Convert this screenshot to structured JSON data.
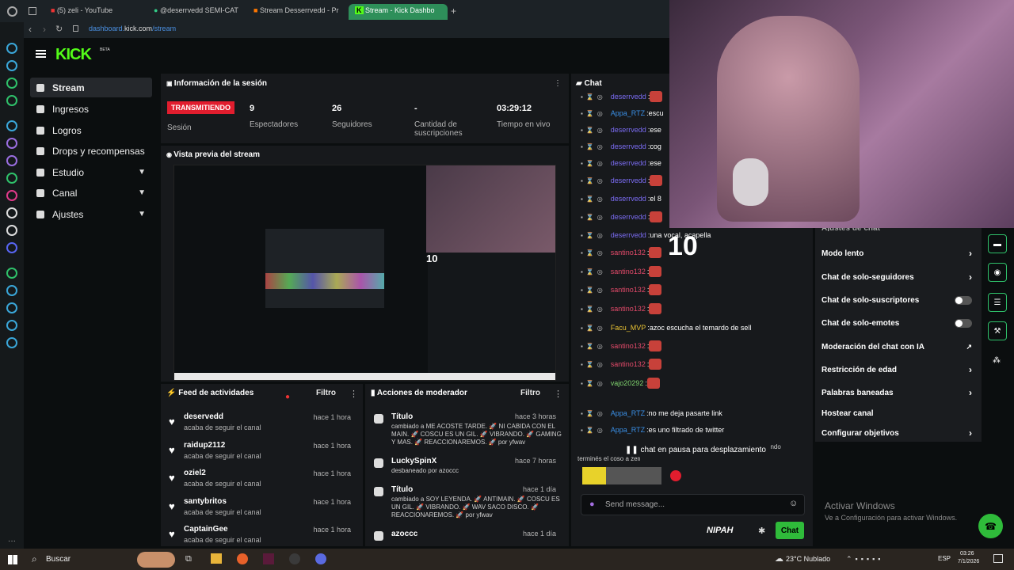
{
  "browser": {
    "tabs": [
      "(5) zeli - YouTube",
      "@deserrvedd SEMI-CAT",
      "Stream Desserrvedd - Pr",
      "Stream - Kick Dashbo"
    ],
    "url_path": "dashboard.",
    "url_host": "kick.com",
    "url_rest": "/stream"
  },
  "kick": {
    "logo": "KICK",
    "logo_badge": "BETA",
    "nav": [
      {
        "label": "Stream",
        "icon": "stream-icon"
      },
      {
        "label": "Ingresos",
        "icon": "money-icon"
      },
      {
        "label": "Logros",
        "icon": "trophy-icon"
      },
      {
        "label": "Drops y recompensas",
        "icon": "gift-icon"
      },
      {
        "label": "Estudio",
        "icon": "pen-icon"
      },
      {
        "label": "Canal",
        "icon": "user-icon"
      },
      {
        "label": "Ajustes",
        "icon": "gear-icon"
      }
    ],
    "session": {
      "title": "Información de la sesión",
      "live_badge": "TRANSMITIENDO",
      "session_label": "Sesión",
      "stats": [
        {
          "value": "9",
          "label": "Espectadores"
        },
        {
          "value": "26",
          "label": "Seguidores"
        },
        {
          "value": "-",
          "label": "Cantidad de suscripciones"
        },
        {
          "value": "03:29:12",
          "label": "Tiempo en vivo"
        }
      ]
    },
    "preview": {
      "title": "Vista previa del stream",
      "big_number": "10"
    },
    "feed": {
      "title": "Feed de actividades",
      "filter": "Filtro",
      "items": [
        {
          "user": "deservedd",
          "text": "acaba de seguir el canal",
          "time": "hace 1 hora"
        },
        {
          "user": "raidup2112",
          "text": "acaba de seguir el canal",
          "time": "hace 1 hora"
        },
        {
          "user": "oziel2",
          "text": "acaba de seguir el canal",
          "time": "hace 1 hora"
        },
        {
          "user": "santybritos",
          "text": "acaba de seguir el canal",
          "time": "hace 1 hora"
        },
        {
          "user": "CaptainGee",
          "text": "acaba de seguir el canal",
          "time": "hace 1 hora"
        }
      ]
    },
    "mod": {
      "title": "Acciones de moderador",
      "filter": "Filtro",
      "items": [
        {
          "title": "Título",
          "time": "hace 3 horas",
          "desc": "cambiado a ME ACOSTE TARDE. 🚀 NI CABIDA CON EL MAIN. 🚀 COSCU ES UN GIL. 🚀 VIBRANDO. 🚀 GAMING Y MAS. 🚀 REACCIONAREMOS. 🚀 por yfwav"
        },
        {
          "title": "LuckySpinX",
          "time": "hace 7 horas",
          "desc": "desbaneado por azoccc"
        },
        {
          "title": "Título",
          "time": "hace 1 día",
          "desc": "cambiado a SOY LEYENDA. 🚀 ANTIMAIN. 🚀 COSCU ES UN GIL. 🚀 VIBRANDO. 🚀 WAV SACO DISCO. 🚀 REACCIONAREMOS. 🚀 por yfwav"
        },
        {
          "title": "azoccc",
          "time": "hace 1 día",
          "desc": ""
        }
      ]
    },
    "chat": {
      "title": "Chat",
      "lines": [
        {
          "user": "deserrvedd",
          "msg": "",
          "color": "#7b6cf3"
        },
        {
          "user": "Appa_RTZ",
          "msg": "escu",
          "color": "#3a8fe6"
        },
        {
          "user": "deserrvedd",
          "msg": "ese",
          "color": "#7b6cf3"
        },
        {
          "user": "deserrvedd",
          "msg": "cog",
          "color": "#7b6cf3"
        },
        {
          "user": "deserrvedd",
          "msg": "ese",
          "color": "#7b6cf3"
        },
        {
          "user": "deserrvedd",
          "msg": "",
          "color": "#7b6cf3"
        },
        {
          "user": "deserrvedd",
          "msg": "el 8",
          "color": "#7b6cf3"
        },
        {
          "user": "deserrvedd",
          "msg": "",
          "color": "#7b6cf3"
        },
        {
          "user": "deserrvedd",
          "msg": "una vocal, acapella",
          "color": "#7b6cf3"
        },
        {
          "user": "santino132",
          "msg": "",
          "color": "#e34a6a"
        },
        {
          "user": "santino132",
          "msg": "",
          "color": "#e34a6a"
        },
        {
          "user": "santino132",
          "msg": "",
          "color": "#e34a6a"
        },
        {
          "user": "santino132",
          "msg": "",
          "color": "#e34a6a"
        },
        {
          "user": "Facu_MVP",
          "msg": "azoc escucha el temardo de sell",
          "color": "#e8c233"
        },
        {
          "user": "santino132",
          "msg": "",
          "color": "#e34a6a"
        },
        {
          "user": "santino132",
          "msg": "",
          "color": "#e34a6a"
        },
        {
          "user": "vajo20292",
          "msg": "",
          "color": "#7fd36e"
        },
        {
          "user": "Appa_RTZ",
          "msg": "no me deja pasarte link",
          "color": "#3a8fe6"
        },
        {
          "user": "Appa_RTZ",
          "msg": "es uno filtrado de twitter",
          "color": "#3a8fe6"
        }
      ],
      "partial_line": "terminés el coso a zeli",
      "partial_tail": "ando",
      "paused": "chat en pausa para desplazamiento",
      "input_placeholder": "Send message...",
      "nipah": "NIPAH",
      "send": "Chat",
      "overlay_number": "10"
    },
    "chat_settings": {
      "header": "Ajustes de chat",
      "items": [
        {
          "label": "Modo lento",
          "control": "arrow"
        },
        {
          "label": "Chat de solo-seguidores",
          "control": "arrow"
        },
        {
          "label": "Chat de solo-suscriptores",
          "control": "toggle"
        },
        {
          "label": "Chat de solo-emotes",
          "control": "toggle"
        },
        {
          "label": "Moderación del chat con IA",
          "control": "external"
        },
        {
          "label": "Restricción de edad",
          "control": "arrow"
        },
        {
          "label": "Palabras baneadas",
          "control": "arrow"
        },
        {
          "label": "Hostear canal",
          "control": "none"
        },
        {
          "label": "Configurar objetivos",
          "control": "arrow"
        }
      ]
    }
  },
  "watermark": {
    "title": "Activar Windows",
    "sub": "Ve a Configuración para activar Windows."
  },
  "taskbar": {
    "search": "Buscar",
    "weather": "23°C Nublado",
    "lang": "ESP",
    "time": "03:26",
    "date": "7/1/2026"
  }
}
